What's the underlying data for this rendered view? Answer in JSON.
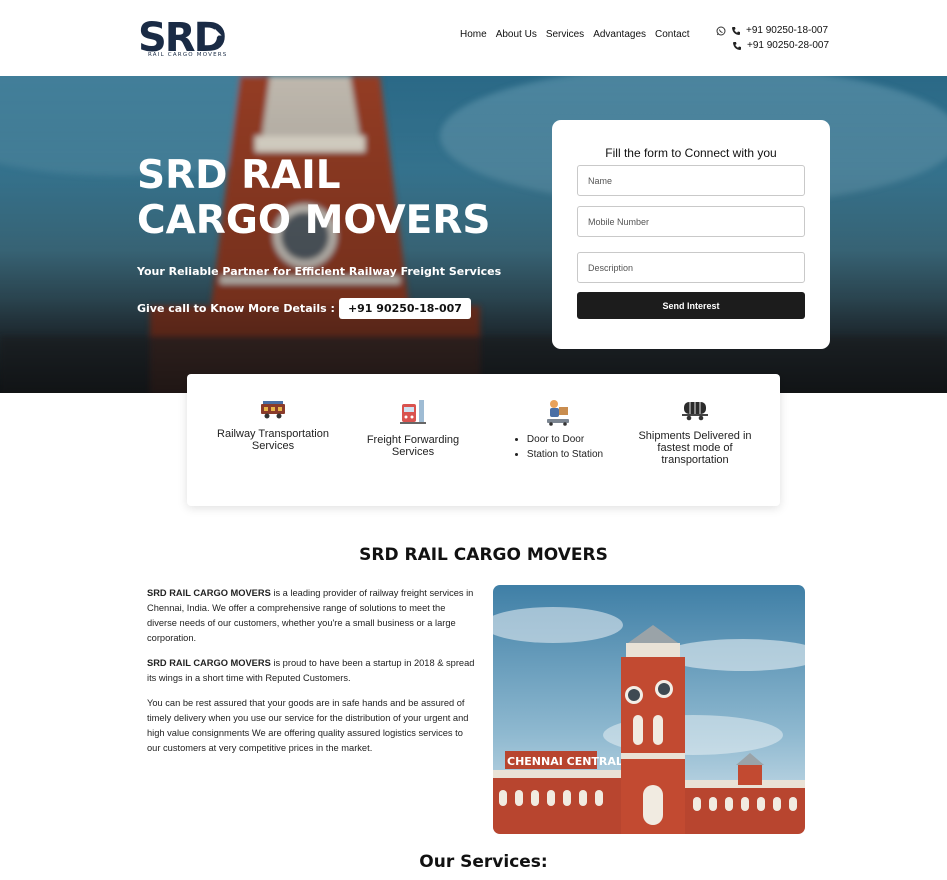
{
  "brand": {
    "logo_text": "SRD",
    "tagline": "RAIL CARGO MOVERS"
  },
  "nav": {
    "items": [
      {
        "label": "Home"
      },
      {
        "label": "About Us"
      },
      {
        "label": "Services"
      },
      {
        "label": "Advantages"
      },
      {
        "label": "Contact"
      }
    ]
  },
  "contact": {
    "phone1": "+91 90250-18-007",
    "phone2": "+91 90250-28-007"
  },
  "hero": {
    "title": "SRD RAIL CARGO MOVERS",
    "subtitle": "Your Reliable Partner for Efficient Railway Freight Services",
    "call_label": "Give call to Know More Details :",
    "call_number": "+91 90250-18-007"
  },
  "form": {
    "title": "Fill the form to Connect with you",
    "name_placeholder": "Name",
    "mobile_placeholder": "Mobile Number",
    "description_placeholder": "Description",
    "submit_label": "Send Interest"
  },
  "features": {
    "items": [
      {
        "label": "Railway Transportation Services",
        "icon": "freight-wagon-icon"
      },
      {
        "label": "Freight Forwarding Services",
        "icon": "train-station-icon"
      },
      {
        "bullets": [
          "Door to Door",
          "Station to Station"
        ],
        "icon": "delivery-worker-icon"
      },
      {
        "label": "Shipments Delivered in fastest mode of transportation",
        "icon": "tank-wagon-icon"
      }
    ]
  },
  "about": {
    "title": "SRD RAIL CARGO MOVERS",
    "p1_bold": "SRD RAIL CARGO MOVERS",
    "p1_rest": " is a leading provider of railway freight services in Chennai, India. We offer a comprehensive range of solutions to meet the diverse needs of our customers, whether you're a small business or a large corporation.",
    "p2_bold": "SRD RAIL CARGO MOVERS",
    "p2_rest": " is proud to have been a startup in 2018 & spread its wings in a short time with Reputed Customers.",
    "p3": "You can be rest assured that your goods are in safe hands and be assured of timely delivery when you use our service for the distribution of your urgent and high value consignments We are offering quality assured logistics services to our customers at very competitive prices in the market.",
    "image_sign": "CHENNAI CENTRAL"
  },
  "services": {
    "title": "Our Services:"
  },
  "colors": {
    "navy": "#1a2b45",
    "dark_button": "#1c1c1c",
    "brick": "#b8452f",
    "sky": "#3d84a3"
  }
}
